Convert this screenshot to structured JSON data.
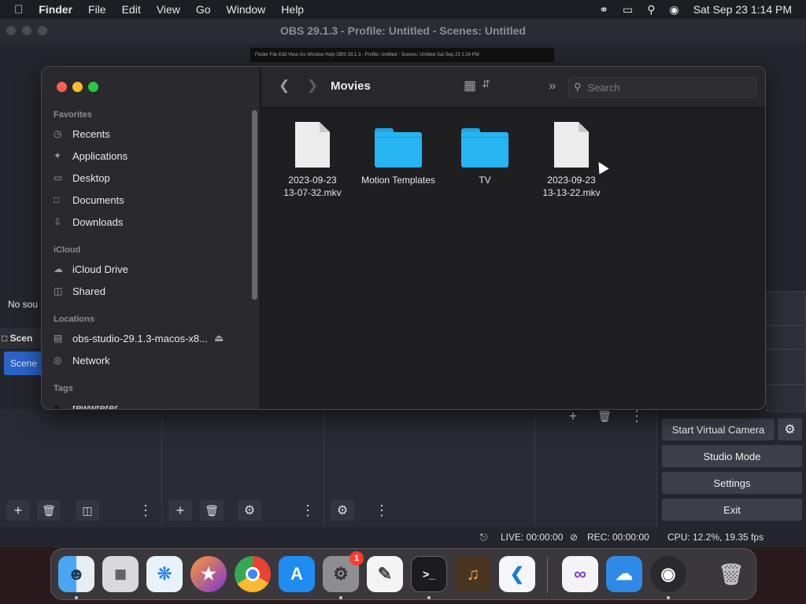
{
  "menubar": {
    "app_name": "Finder",
    "menus": [
      "File",
      "Edit",
      "View",
      "Go",
      "Window",
      "Help"
    ],
    "clock": "Sat Sep 23  1:14 PM"
  },
  "obs": {
    "window_title": "OBS 29.1.3 - Profile: Untitled - Scenes: Untitled",
    "preview_text": "Finder  File  Edit  View  Go  Window  Help        OBS 29.1.3 - Profile: Untitled - Scenes: Untitled                    Sat Sep 23  1:14 PM",
    "no_sources": "No sou",
    "scenes_label": "Scen",
    "scene_item": "Scene",
    "controls": {
      "virtual_camera": "Start Virtual Camera",
      "studio_mode": "Studio Mode",
      "settings": "Settings",
      "exit": "Exit"
    },
    "status": {
      "live": "LIVE: 00:00:00",
      "rec": "REC: 00:00:00",
      "cpu": "CPU: 12.2%, 19.35 fps"
    }
  },
  "finder": {
    "title": "Movies",
    "search_placeholder": "Search",
    "sidebar": {
      "favorites_header": "Favorites",
      "favorites": [
        "Recents",
        "Applications",
        "Desktop",
        "Documents",
        "Downloads"
      ],
      "icloud_header": "iCloud",
      "icloud": [
        "iCloud Drive",
        "Shared"
      ],
      "locations_header": "Locations",
      "locations": [
        "obs-studio-29.1.3-macos-x8...",
        "Network"
      ],
      "tags_header": "Tags",
      "tags": [
        "rewwrerer"
      ]
    },
    "files": [
      {
        "name_line1": "2023-09-23",
        "name_line2": "13-07-32.mkv",
        "kind": "document"
      },
      {
        "name_line1": "Motion Templates",
        "name_line2": "",
        "kind": "folder"
      },
      {
        "name_line1": "TV",
        "name_line2": "",
        "kind": "folder"
      },
      {
        "name_line1": "2023-09-23",
        "name_line2": "13-13-22.mkv",
        "kind": "document"
      }
    ]
  },
  "dock": {
    "apps": [
      "Finder",
      "Launchpad",
      "Safari",
      "Firefox",
      "Chrome",
      "App Store",
      "System Settings",
      "TextEdit",
      "Terminal",
      "GarageBand",
      "VS Code",
      "Visual Studio",
      "Weather",
      "OBS",
      "Trash"
    ],
    "settings_badge": "1"
  },
  "colors": {
    "accent": "#2a64c8",
    "folder": "#27b4f2",
    "close": "#ff5f57",
    "minimize": "#febc2e",
    "zoom": "#28c840"
  }
}
